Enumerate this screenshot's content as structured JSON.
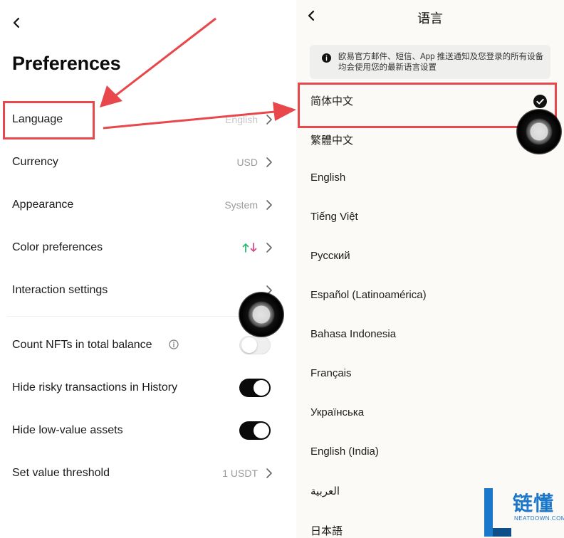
{
  "left": {
    "title": "Preferences",
    "rows": [
      {
        "label": "Language",
        "value": "English"
      },
      {
        "label": "Currency",
        "value": "USD"
      },
      {
        "label": "Appearance",
        "value": "System"
      },
      {
        "label": "Color preferences",
        "value": "↑↓"
      },
      {
        "label": "Interaction settings",
        "value": ""
      }
    ],
    "toggles": [
      {
        "label": "Count NFTs in total balance",
        "on": false
      },
      {
        "label": "Hide risky transactions in History",
        "on": true
      },
      {
        "label": "Hide low-value assets",
        "on": true
      }
    ],
    "threshold": {
      "label": "Set value threshold",
      "value": "1 USDT"
    }
  },
  "right": {
    "title": "语言",
    "notice": "欧易官方邮件、短信、App 推送通知及您登录的所有设备均会使用您的最新语言设置",
    "languages": [
      "简体中文",
      "繁體中文",
      "English",
      "Tiếng Việt",
      "Русский",
      "Español (Latinoamérica)",
      "Bahasa Indonesia",
      "Français",
      "Українська",
      "English (India)",
      "العربية",
      "日本語"
    ],
    "selected_index": 0
  },
  "watermark": {
    "cn": "链懂",
    "en": "NEATDOWN.COM"
  },
  "colors": {
    "annotation_red": "#e8474c",
    "up_green": "#2fb872",
    "down_pink": "#d64d8e",
    "brand_blue": "#1b77c9"
  }
}
